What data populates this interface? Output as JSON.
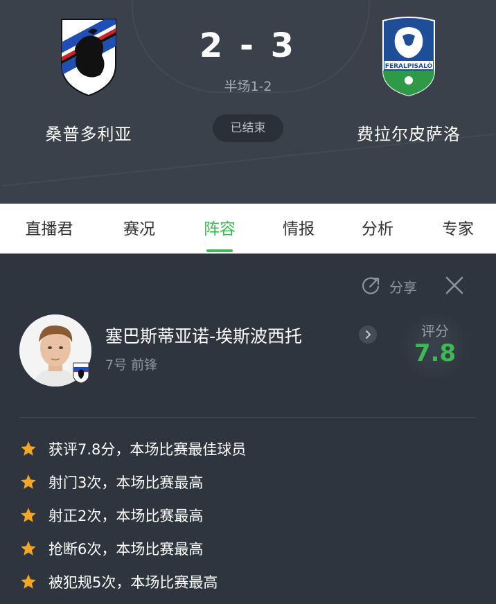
{
  "match": {
    "home_team": "桑普多利亚",
    "away_team": "费拉尔皮萨洛",
    "score": "2 - 3",
    "halftime": "半场1-2",
    "status": "已结束",
    "away_crest_text": "FERALPISALÒ"
  },
  "tabs": [
    {
      "label": "直播君"
    },
    {
      "label": "赛况"
    },
    {
      "label": "阵容",
      "active": true
    },
    {
      "label": "情报"
    },
    {
      "label": "分析"
    },
    {
      "label": "专家"
    }
  ],
  "player": {
    "name": "塞巴斯蒂亚诺-埃斯波西托",
    "meta": "7号 前锋",
    "rating_label": "评分",
    "rating": "7.8"
  },
  "actions": {
    "share_label": "分享"
  },
  "highlights": [
    {
      "text": "获评7.8分，本场比赛最佳球员"
    },
    {
      "text": "射门3次，本场比赛最高"
    },
    {
      "text": "射正2次，本场比赛最高"
    },
    {
      "text": "抢断6次，本场比赛最高"
    },
    {
      "text": "被犯规5次，本场比赛最高"
    }
  ],
  "colors": {
    "accent": "#3dbb52",
    "header_bg": "#3a414a",
    "panel_bg": "#2f353e",
    "star": "#f5a623"
  }
}
